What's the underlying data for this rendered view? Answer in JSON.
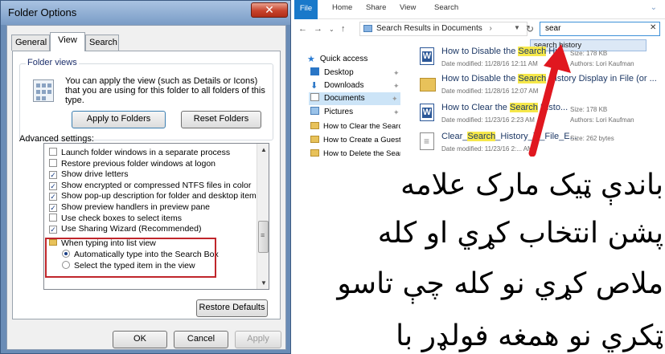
{
  "dialog": {
    "title": "Folder Options",
    "close_label": "✕",
    "tabs": [
      "General",
      "View",
      "Search"
    ],
    "folder_views": {
      "legend": "Folder views",
      "description": "You can apply the view (such as Details or Icons) that you are using for this folder to all folders of this type.",
      "apply_button": "Apply to Folders",
      "reset_button": "Reset Folders"
    },
    "advanced_label": "Advanced settings:",
    "advanced_items": [
      {
        "type": "checkbox",
        "checked": false,
        "label": "Launch folder windows in a separate process"
      },
      {
        "type": "checkbox",
        "checked": false,
        "label": "Restore previous folder windows at logon"
      },
      {
        "type": "checkbox",
        "checked": true,
        "label": "Show drive letters"
      },
      {
        "type": "checkbox",
        "checked": true,
        "label": "Show encrypted or compressed NTFS files in color"
      },
      {
        "type": "checkbox",
        "checked": true,
        "label": "Show pop-up description for folder and desktop items"
      },
      {
        "type": "checkbox",
        "checked": true,
        "label": "Show preview handlers in preview pane"
      },
      {
        "type": "checkbox",
        "checked": false,
        "label": "Use check boxes to select items"
      },
      {
        "type": "checkbox",
        "checked": true,
        "label": "Use Sharing Wizard (Recommended)"
      },
      {
        "type": "folder",
        "label": "When typing into list view"
      },
      {
        "type": "radio",
        "checked": true,
        "label": "Automatically type into the Search Box"
      },
      {
        "type": "radio",
        "checked": false,
        "label": "Select the typed item in the view"
      }
    ],
    "restore_defaults": "Restore Defaults",
    "ok": "OK",
    "cancel": "Cancel",
    "apply": "Apply"
  },
  "explorer": {
    "ribbon_tabs": [
      "File",
      "Home",
      "Share",
      "View",
      "Search"
    ],
    "address": "Search Results in Documents",
    "search_value": "sear",
    "search_suggestion": "search history",
    "nav_items": [
      "Quick access",
      "Desktop",
      "Downloads",
      "Documents",
      "Pictures"
    ],
    "sub_folders": [
      "How to Clear the Search",
      "How to Create a Guest A",
      "How to Delete the Search"
    ],
    "results": [
      {
        "pre": "How to Disable the ",
        "hl": "Search",
        "post": " Hi...",
        "modified": "Date modified: 11/28/16 12:11 AM",
        "size": "Size: 178 KB",
        "authors": "Authors: Lori Kaufman",
        "icon": "word"
      },
      {
        "pre": "How to Disable the ",
        "hl": "Search",
        "post": " History Display in File (or ...",
        "modified": "Date modified: 11/28/16 12:07 AM",
        "size": "",
        "authors": "",
        "icon": "folder"
      },
      {
        "pre": "How to Clear the ",
        "hl": "Search",
        "post": " Histo...",
        "modified": "Date modified: 11/23/16 2:23 AM",
        "size": "Size: 178 KB",
        "authors": "Authors: Lori Kaufman",
        "icon": "word"
      },
      {
        "pre": "Clear_",
        "hl": "Search",
        "post": "_History_in_File_E...",
        "modified": "Date modified: 11/23/16 2:... AM",
        "size": "Size: 262 bytes",
        "authors": "",
        "icon": "text"
      }
    ]
  },
  "caption": {
    "lines": [
      "باندې ټيک مارک علامه",
      "پشن انتخاب کړي او کله",
      "ملاص کړي نو کله چې تاسو",
      "ټکري نو همغه فولډر با"
    ]
  },
  "colors": {
    "highlight": "#f6e84a",
    "annotation_red": "#c0262b",
    "file_tab_blue": "#1979ca"
  }
}
